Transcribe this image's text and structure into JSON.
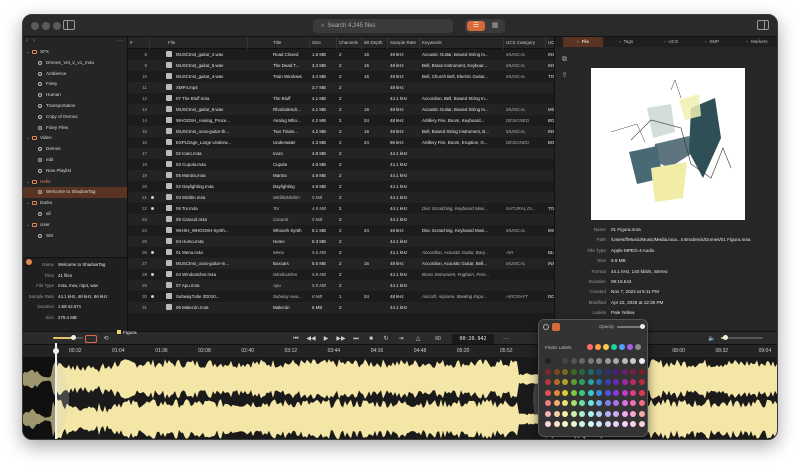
{
  "window": {
    "search_placeholder": "Search 4,245 files",
    "view_list_icon": "list-icon",
    "view_grid_icon": "grid-icon"
  },
  "sidebar": {
    "items": [
      {
        "label": "SFX",
        "type": "folder"
      },
      {
        "label": "Drones_Vol_2_v1_m4a",
        "type": "fx"
      },
      {
        "label": "Ambience",
        "type": "fx"
      },
      {
        "label": "Foley",
        "type": "fx"
      },
      {
        "label": "Human",
        "type": "fx"
      },
      {
        "label": "Transportation",
        "type": "fx"
      },
      {
        "label": "Copy of Demos",
        "type": "fx"
      },
      {
        "label": "Foley Files",
        "type": "fx"
      },
      {
        "label": "Video",
        "type": "folder"
      },
      {
        "label": "Demos",
        "type": "fx"
      },
      {
        "label": "edit",
        "type": "fx"
      },
      {
        "label": "New Playlist",
        "type": "fx"
      },
      {
        "label": "Hello",
        "type": "folder"
      },
      {
        "label": "Welcome to ShadowTag",
        "type": "fx"
      },
      {
        "label": "Darko",
        "type": "folder"
      },
      {
        "label": "all",
        "type": "fx"
      },
      {
        "label": "User",
        "type": "folder"
      },
      {
        "label": "SM",
        "type": "fx"
      }
    ],
    "info": [
      {
        "k": "Name",
        "v": "Welcome to ShadowTag"
      },
      {
        "k": "Files",
        "v": "41 files"
      },
      {
        "k": "File Type",
        "v": "m4a, mov, mp4, wav"
      },
      {
        "k": "Sample Rate",
        "v": "44.1 kHz, 48 kHz, 96 kHz"
      },
      {
        "k": "Duration",
        "v": "1:58:42.571"
      },
      {
        "k": "Size",
        "v": "279.4 MB"
      }
    ]
  },
  "table": {
    "columns": [
      "#",
      "File",
      "Title",
      "Size",
      "Channels",
      "Bit Depth",
      "Sample Rate",
      "Keywords",
      "UCS Category",
      "UCS Subcate"
    ],
    "rows": [
      {
        "n": "8",
        "file": "MUSCInst_guitar_2.wav",
        "title": "Road Closed",
        "size": "1.6 MB",
        "ch": "2",
        "bd": "16",
        "sr": "48 kHz",
        "kw": "Acoustic Guitar, Bowed String In...",
        "cat": "MUSICAL",
        "sub": "INSTRUME"
      },
      {
        "n": "9",
        "file": "MUSCInst_guitar_5.wav",
        "title": "The Dead T...",
        "size": "3.3 MB",
        "ch": "2",
        "bd": "16",
        "sr": "48 kHz",
        "kw": "Bell, Brass Instrument, Keyboar...",
        "cat": "MUSICAL",
        "sub": "INSTRUME"
      },
      {
        "n": "10",
        "file": "MUSCInst_guitar_4.wav",
        "title": "Train Windows",
        "size": "3.4 MB",
        "ch": "2",
        "bd": "16",
        "sr": "48 kHz",
        "kw": "Bell, Church Bell, Electric Guitar...",
        "cat": "MUSICAL",
        "sub": "TOY"
      },
      {
        "n": "11",
        "file": "XMP4.mp4",
        "title": "",
        "size": "3.7 MB",
        "ch": "2",
        "bd": "",
        "sr": "48 kHz",
        "kw": "",
        "cat": "",
        "sub": ""
      },
      {
        "n": "12",
        "file": "07 The Bluff.m4a",
        "title": "The Bluff",
        "size": "4.1 MB",
        "ch": "2",
        "bd": "",
        "sr": "44.1 kHz",
        "kw": "Accordion, Bell, Bowed String In...",
        "cat": "",
        "sub": ""
      },
      {
        "n": "13",
        "file": "MUSCInst_guitar_8.wav",
        "title": "Rhododendr...",
        "size": "4.1 MB",
        "ch": "2",
        "bd": "16",
        "sr": "48 kHz",
        "kw": "Acoustic Guitar, Bowed String In...",
        "cat": "MUSICAL",
        "sub": "MISC"
      },
      {
        "n": "14",
        "file": "WHOOSH_Analog_Proce...",
        "title": "Analog Who...",
        "size": "4.2 MB",
        "ch": "2",
        "bd": "24",
        "sr": "48 kHz",
        "kw": "Artillery Fire, Boom, Keyboard...",
        "cat": "DESIGNED",
        "sub": "BOOM"
      },
      {
        "n": "15",
        "file": "MUSCInst_ocva-guitar-th...",
        "title": "Two Trains...",
        "size": "4.2 MB",
        "ch": "2",
        "bd": "16",
        "sr": "48 kHz",
        "kw": "Bell, Bowed String Instrument, B...",
        "cat": "MUSICAL",
        "sub": "INSTRUME"
      },
      {
        "n": "16",
        "file": "EXPLDsgn_Large Underw...",
        "title": "Underwater",
        "size": "4.3 MB",
        "ch": "2",
        "bd": "24",
        "sr": "96 kHz",
        "kw": "Artillery Fire, Boom, Eruption, G...",
        "cat": "DESIGNED",
        "sub": "BOOM"
      },
      {
        "n": "17",
        "file": "02 Icaro.m4a",
        "title": "Icaro",
        "size": "4.8 MB",
        "ch": "2",
        "bd": "",
        "sr": "44.1 kHz",
        "kw": "",
        "cat": "",
        "sub": ""
      },
      {
        "n": "18",
        "file": "03 Cupola.m4a",
        "title": "Cupola",
        "size": "4.8 MB",
        "ch": "2",
        "bd": "",
        "sr": "44.1 kHz",
        "kw": "",
        "cat": "",
        "sub": ""
      },
      {
        "n": "19",
        "file": "05 Mantra.m4a",
        "title": "Mantra",
        "size": "4.9 MB",
        "ch": "2",
        "bd": "",
        "sr": "44.1 kHz",
        "kw": "",
        "cat": "",
        "sub": ""
      },
      {
        "n": "20",
        "file": "02 Daylighting.m4a",
        "title": "Daylighting",
        "size": "4.9 MB",
        "ch": "2",
        "bd": "",
        "sr": "44.1 kHz",
        "kw": "",
        "cat": "",
        "sub": ""
      },
      {
        "n": "21",
        "file": "03 Miclitin.m4a",
        "title": "MiclitinMiclitin",
        "size": "5 MB",
        "ch": "2",
        "bd": "",
        "sr": "44.1 kHz",
        "kw": "",
        "cat": "",
        "sub": "",
        "italic": true,
        "dot": true
      },
      {
        "n": "22",
        "file": "06 Tor.m4a",
        "title": "Tor",
        "size": "4.9 MB",
        "ch": "2",
        "bd": "",
        "sr": "44.1 kHz",
        "kw": "Disc Scratching, Keyboard Musi...",
        "cat": "NATURAL DI...",
        "sub": "TORNADO",
        "italic": true,
        "dot": true
      },
      {
        "n": "23",
        "file": "05 Caracol.m4a",
        "title": "Caracol",
        "size": "5 MB",
        "ch": "2",
        "bd": "",
        "sr": "44.1 kHz",
        "kw": "",
        "cat": "",
        "sub": "",
        "italic": true
      },
      {
        "n": "24",
        "file": "WHSH_WHOOSH-Synth...",
        "title": "Whoosh Synth",
        "size": "5.1 MB",
        "ch": "2",
        "bd": "24",
        "sr": "48 kHz",
        "kw": "Disc Scratching, Keyboard Musi...",
        "cat": "MUSICAL",
        "sub": "MISC"
      },
      {
        "n": "25",
        "file": "04 Humo.m4a",
        "title": "Humo",
        "size": "5.3 MB",
        "ch": "2",
        "bd": "",
        "sr": "44.1 kHz",
        "kw": "",
        "cat": "",
        "sub": ""
      },
      {
        "n": "26",
        "file": "01 Menu.m4a",
        "title": "Menu",
        "size": "5.6 MB",
        "ch": "2",
        "bd": "",
        "sr": "44.1 kHz",
        "kw": "Accordion, Acoustic Guitar, Banj...",
        "cat": "AIR",
        "sub": "BLOW",
        "italic": true,
        "dot": true
      },
      {
        "n": "27",
        "file": "MUSCInst_ocva-guitar-m...",
        "title": "Boxcars",
        "size": "5.5 MB",
        "ch": "2",
        "bd": "16",
        "sr": "48 kHz",
        "kw": "Accordion, Acoustic Guitar, Bell...",
        "cat": "MUSICAL",
        "sub": "INSTRUME"
      },
      {
        "n": "28",
        "file": "04 Windcatcher.m4a",
        "title": "Windcatcher",
        "size": "5.8 MB",
        "ch": "2",
        "bd": "",
        "sr": "44.1 kHz",
        "kw": "Brass Instrument, Foghorn, Fren...",
        "cat": "",
        "sub": "",
        "italic": true,
        "dot": true
      },
      {
        "n": "29",
        "file": "07 Apu.m4a",
        "title": "Apu",
        "size": "5.9 MB",
        "ch": "2",
        "bd": "",
        "sr": "44.1 kHz",
        "kw": "",
        "cat": "",
        "sub": "",
        "italic": true
      },
      {
        "n": "30",
        "file": "SubwayTube 3D010...",
        "title": "Subway Awa...",
        "size": "6 MB",
        "ch": "1",
        "bd": "24",
        "sr": "48 kHz",
        "kw": "Aircraft, Airplane, Bowling Impa...",
        "cat": "AIRCRAFT",
        "sub": "DOOR",
        "italic": true,
        "dot": true
      },
      {
        "n": "31",
        "file": "06 Malecón.m4a",
        "title": "Malecón",
        "size": "6 MB",
        "ch": "2",
        "bd": "",
        "sr": "44.1 kHz",
        "kw": "",
        "cat": "",
        "sub": ""
      }
    ]
  },
  "rpanel": {
    "tabs": [
      "File",
      "Tags",
      "UCS",
      "XMP",
      "Markers"
    ],
    "meta": [
      {
        "k": "Name",
        "v": "01 Figura.m4a"
      },
      {
        "k": "Path",
        "v": "/Users/f/Music/Music/Media.loca...s Broderick/Domes/01 Figura.m4a"
      },
      {
        "k": "File Type",
        "v": "Apple MPEG-4 Audio"
      },
      {
        "k": "Size",
        "v": "9.9 MB"
      },
      {
        "k": "Format",
        "v": "44.1 kHz, 140 kbit/s, Stereo"
      },
      {
        "k": "Duration",
        "v": "09:16.544"
      },
      {
        "k": "Created",
        "v": "Nov 7, 2022 at 5:11 PM"
      },
      {
        "k": "Modified",
        "v": "Apr 22, 2026 at 12:35 PM"
      },
      {
        "k": "Labels",
        "v": "Pale Yellow"
      },
      {
        "k": "Colors",
        "v": ""
      }
    ]
  },
  "transport": {
    "bpm": "60",
    "timecode": "00:20.942"
  },
  "waveform": {
    "region_label": "Figura",
    "ruler": [
      "00:32",
      "01:04",
      "01:36",
      "02:08",
      "02:40",
      "03:12",
      "03:44",
      "04:16",
      "04:48",
      "05:20",
      "05:52",
      "06:24",
      "06:56",
      "07:28",
      "08:00",
      "08:32",
      "09:04"
    ],
    "color": "#f3e6a6",
    "played_color": "#d9cd94"
  },
  "popover": {
    "opacity_label": "Opacity",
    "finder_labels": "Finder Labels"
  }
}
